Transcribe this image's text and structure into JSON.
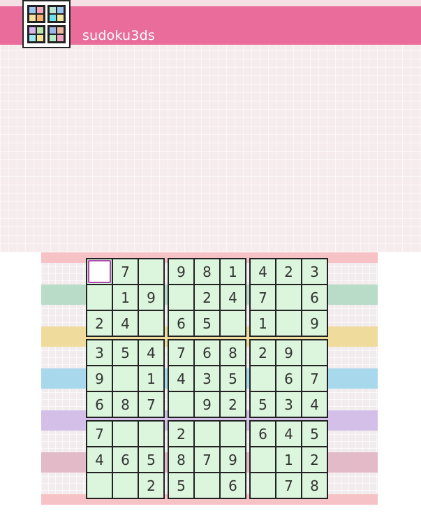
{
  "app": {
    "title": "sudoku3ds",
    "icon": "sudoku-grid-icon"
  },
  "colors": {
    "title_bar": "#ea6c9a",
    "cell_bg": "#dbf6dd",
    "grid_line": "#222222",
    "selection": "#b04ab0",
    "bands": [
      "#f7c2c6",
      "#b9dcc9",
      "#efdc9c",
      "#a8d8ec",
      "#d4bfe8",
      "#e2bac8",
      "#f7c2c6"
    ]
  },
  "board": {
    "selected_cell": [
      0,
      0
    ],
    "rows": [
      [
        "",
        "7",
        "",
        "9",
        "8",
        "1",
        "4",
        "2",
        "3"
      ],
      [
        "",
        "1",
        "9",
        "",
        "2",
        "4",
        "7",
        "",
        "6"
      ],
      [
        "2",
        "4",
        "",
        "6",
        "5",
        "",
        "1",
        "",
        "9"
      ],
      [
        "3",
        "5",
        "4",
        "7",
        "6",
        "8",
        "2",
        "9",
        ""
      ],
      [
        "9",
        "",
        "1",
        "4",
        "3",
        "5",
        "",
        "6",
        "7"
      ],
      [
        "6",
        "8",
        "7",
        "",
        "9",
        "2",
        "5",
        "3",
        "4"
      ],
      [
        "7",
        "",
        "",
        "2",
        "",
        "",
        "6",
        "4",
        "5"
      ],
      [
        "4",
        "6",
        "5",
        "8",
        "7",
        "9",
        "",
        "1",
        "2"
      ],
      [
        "",
        "",
        "2",
        "5",
        "",
        "6",
        "",
        "7",
        "8"
      ]
    ]
  }
}
